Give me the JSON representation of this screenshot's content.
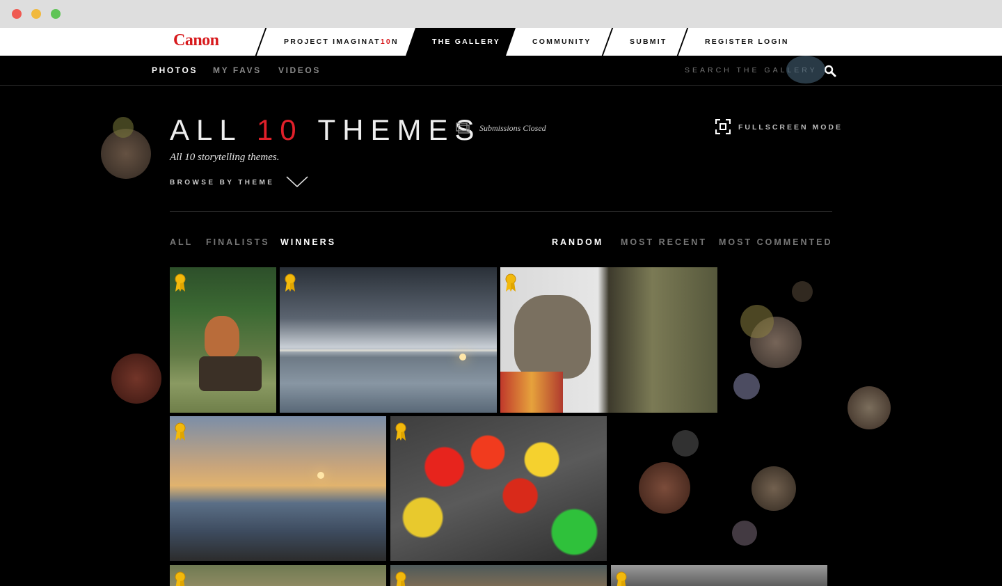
{
  "topnav": {
    "logo": "Canon",
    "items": [
      {
        "label_main": "PROJECT IMAGINAT",
        "label_accent": "10",
        "label_tail": "N"
      },
      {
        "label": "THE GALLERY"
      },
      {
        "label": "COMMUNITY"
      },
      {
        "label": "SUBMIT"
      },
      {
        "label": "REGISTER  LOGIN"
      }
    ]
  },
  "subnav": {
    "items": [
      "PHOTOS",
      "MY FAVS",
      "VIDEOS"
    ],
    "active": "PHOTOS",
    "search_placeholder": "SEARCH THE GALLERY"
  },
  "heading": {
    "title_prefix": "ALL ",
    "title_number": "10",
    "title_suffix": " THEMES",
    "status": "Submissions Closed",
    "fullscreen_label": "FULLSCREEN MODE",
    "tagline": "All 10 storytelling themes.",
    "browse_label": "BROWSE BY THEME"
  },
  "filters": {
    "left": [
      "ALL",
      "FINALISTS",
      "WINNERS"
    ],
    "left_active": "WINNERS",
    "right": [
      "RANDOM",
      "MOST RECENT",
      "MOST COMMENTED"
    ],
    "right_active": "RANDOM"
  },
  "photos": [
    {
      "subject": "fox on tree stump",
      "winner": true
    },
    {
      "subject": "cloudy beach horizon",
      "winner": true
    },
    {
      "subject": "cat by aquarium",
      "winner": true
    },
    {
      "subject": "sunset shoreline",
      "winner": true
    },
    {
      "subject": "gummy bears",
      "winner": true
    },
    {
      "subject": "field",
      "winner": true
    },
    {
      "subject": "animal fur",
      "winner": true
    },
    {
      "subject": "landscape",
      "winner": true
    }
  ],
  "colors": {
    "brand_red": "#d7191c",
    "badge_gold": "#f2b90c",
    "background": "#000000"
  }
}
